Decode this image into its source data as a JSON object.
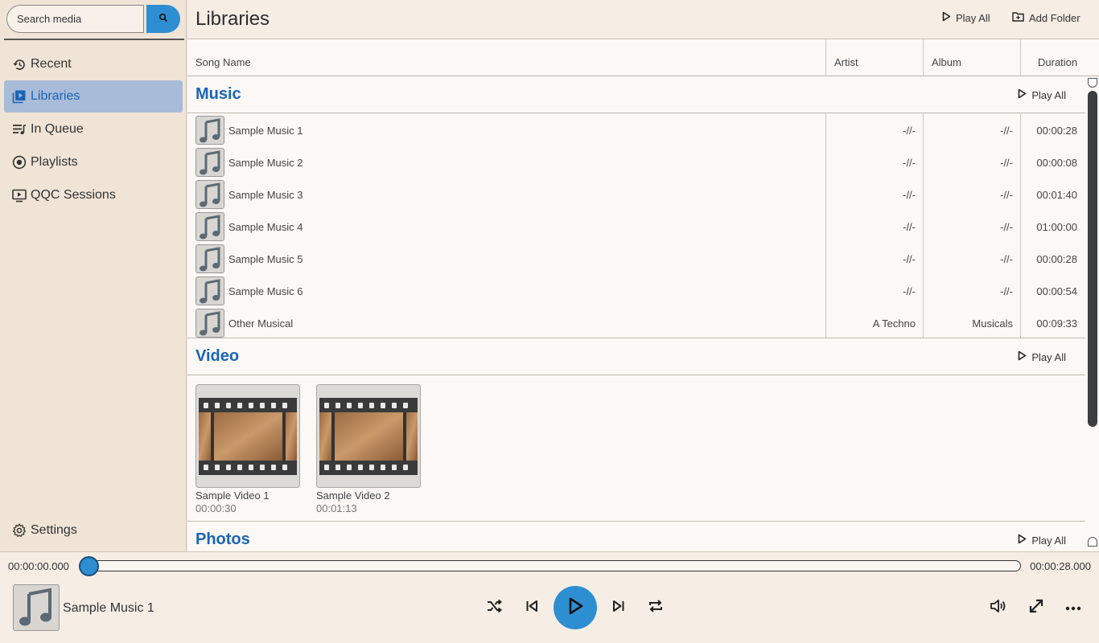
{
  "search": {
    "placeholder": "Search media"
  },
  "sidebar": {
    "items": [
      {
        "label": "Recent",
        "icon": "history-icon"
      },
      {
        "label": "Libraries",
        "icon": "library-icon",
        "active": true
      },
      {
        "label": "In Queue",
        "icon": "queue-icon"
      },
      {
        "label": "Playlists",
        "icon": "playlist-icon"
      },
      {
        "label": "QQC Sessions",
        "icon": "session-icon"
      }
    ],
    "settings_label": "Settings"
  },
  "header": {
    "title": "Libraries",
    "play_all": "Play All",
    "add_folder": "Add Folder"
  },
  "columns": {
    "song_name": "Song Name",
    "artist": "Artist",
    "album": "Album",
    "duration": "Duration"
  },
  "sections": {
    "music": {
      "title": "Music",
      "play_all": "Play All"
    },
    "video": {
      "title": "Video",
      "play_all": "Play All"
    },
    "photos": {
      "title": "Photos",
      "play_all": "Play All"
    }
  },
  "music_rows": [
    {
      "name": "Sample Music 1",
      "artist": "-//-",
      "album": "-//-",
      "duration": "00:00:28"
    },
    {
      "name": "Sample Music 2",
      "artist": "-//-",
      "album": "-//-",
      "duration": "00:00:08"
    },
    {
      "name": "Sample Music 3",
      "artist": "-//-",
      "album": "-//-",
      "duration": "00:01:40"
    },
    {
      "name": "Sample Music 4",
      "artist": "-//-",
      "album": "-//-",
      "duration": "01:00:00"
    },
    {
      "name": "Sample Music 5",
      "artist": "-//-",
      "album": "-//-",
      "duration": "00:00:28"
    },
    {
      "name": "Sample Music 6",
      "artist": "-//-",
      "album": "-//-",
      "duration": "00:00:54"
    },
    {
      "name": "Other Musical",
      "artist": "A Techno",
      "album": "Musicals",
      "duration": "00:09:33"
    }
  ],
  "videos": [
    {
      "name": "Sample Video 1",
      "duration": "00:00:30"
    },
    {
      "name": "Sample Video 2",
      "duration": "00:01:13"
    }
  ],
  "player": {
    "current_time": "00:00:00.000",
    "total_time": "00:00:28.000",
    "progress": 0,
    "now_playing": "Sample Music 1"
  },
  "colors": {
    "accent": "#2d8fd1",
    "section_title": "#1a64b4",
    "sidebar_bg": "#efe4d6",
    "active_nav_bg": "#a8bcd9"
  }
}
